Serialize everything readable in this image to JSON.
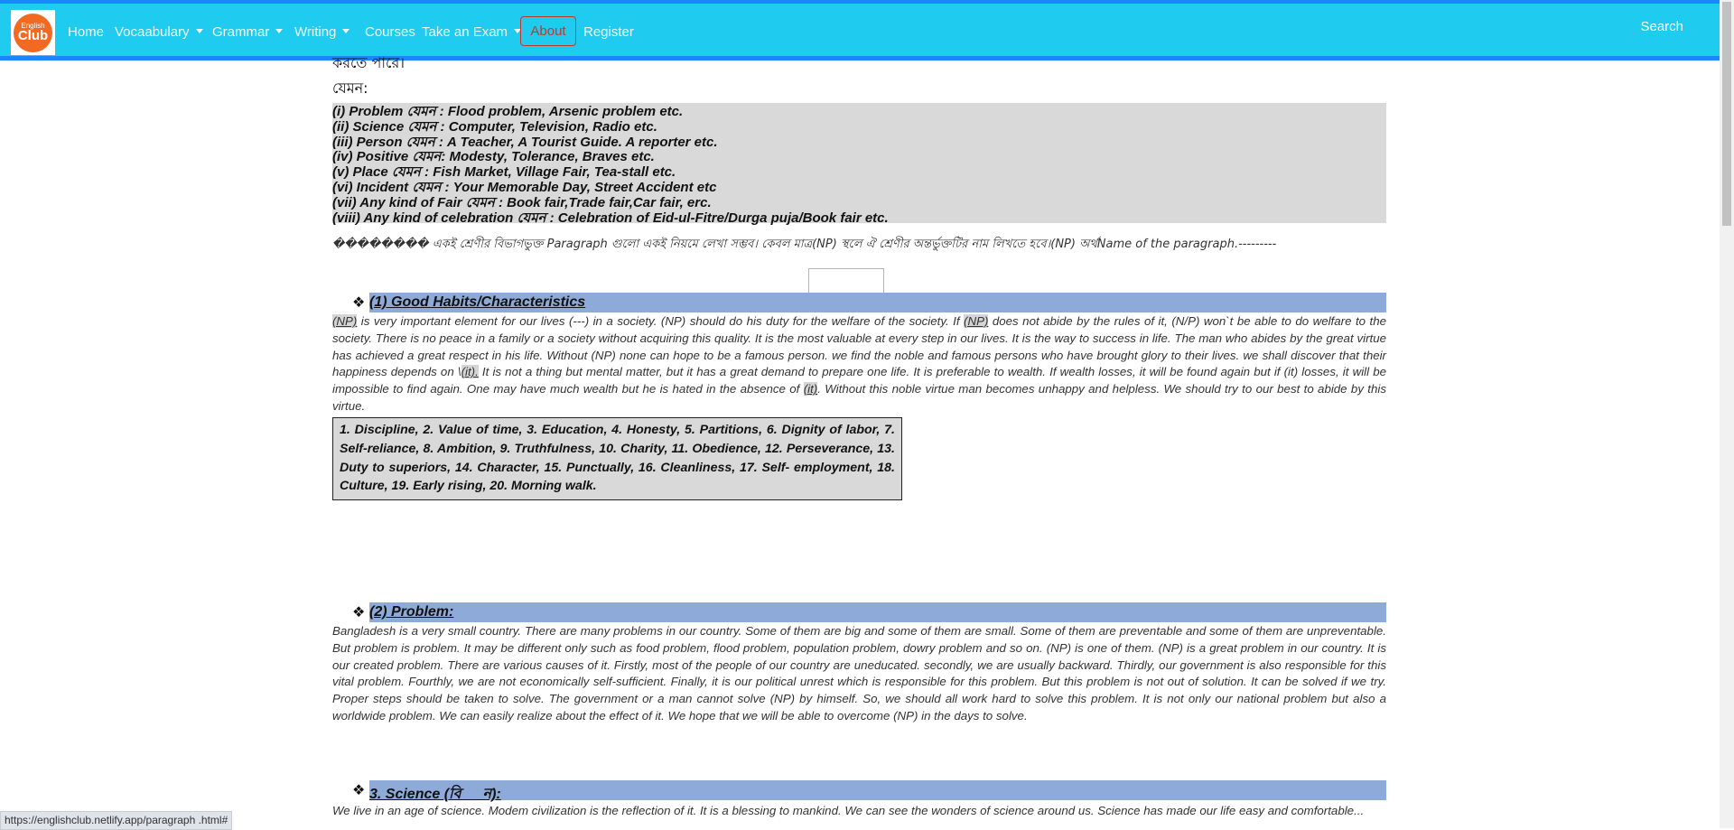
{
  "navbar": {
    "brand": {
      "line1": "English",
      "line2": "Club"
    },
    "items": [
      {
        "label": "Home",
        "dropdown": false
      },
      {
        "label": "Vocaabulary",
        "dropdown": true
      },
      {
        "label": "Grammar",
        "dropdown": true
      },
      {
        "label": "Writing",
        "dropdown": true
      },
      {
        "label": "Courses",
        "dropdown": false
      },
      {
        "label": "Take an Exam",
        "dropdown": true
      },
      {
        "label": "About",
        "dropdown": false
      },
      {
        "label": "Register",
        "dropdown": false
      }
    ],
    "search_label": "Search"
  },
  "content": {
    "cutoff_text": "করতে পারে।",
    "jemon": "যেমন:",
    "examples": [
      "(i) Problem যেমন : Flood problem, Arsenic problem etc.",
      "(ii) Science যেমন : Computer, Television, Radio etc.",
      "(iii) Person যেমন : A Teacher, A Tourist Guide. A reporter etc.",
      "(iv) Positive যেমন: Modesty, Tolerance, Braves etc.",
      "(v) Place যেমন : Fish Market, Village Fair, Tea-stall etc.",
      "(vi) Incident যেমন : Your Memorable Day, Street Accident etc",
      "(vii) Any kind of Fair যেমন : Book fair,Trade fair,Car fair, erc.",
      "(viii) Any kind of celebration  যেমন : Celebration of Eid-ul-Fitre/Durga puja/Book fair etc."
    ],
    "note": "�������� একই শ্রেণীর বিভাগভুক্ত Paragraph গুলো একই নিয়মে লেখা সম্ভব। কেবল মাত্র(NP) স্থলে ঐ শ্রেণীর অন্তর্ভুক্তটির নাম লিখতে হবে।(NP) অর্থName of the paragraph.---------",
    "sections": [
      {
        "bullet": "❖",
        "heading": "(1) Good Habits/Characteristics",
        "body_parts": [
          {
            "hl": true,
            "text": "(NP)"
          },
          {
            "hl": false,
            "text": " is very important element for our lives (---) in a society. (NP) should do his duty for the welfare of the society. If "
          },
          {
            "hl": true,
            "text": "(NP)"
          },
          {
            "hl": false,
            "text": " does not abide by the rules of it, (N/P) won`t be able to do welfare to the society. There is no peace in a family or a society without acquiring this quality. It is the most valuable at every step in our lives.  It is the way to success in life. The man who abides by the great virtue has achieved a great respect in his life. Without (NP) none can hope to be a famous person. we find the noble and famous persons who have brought glory to their lives. we shall discover that their happiness depends on \\"
          },
          {
            "hl": true,
            "text": "(it)."
          },
          {
            "hl": false,
            "text": " It is not a thing but mental matter, but it has a great demand to prepare one life. It is preferable to wealth. If wealth losses, it will be found again but if (it) losses, it will be impossible to find again. One may have much wealth but he is hated in the absence of "
          },
          {
            "hl": true,
            "text": "(it)"
          },
          {
            "hl": false,
            "text": ". Without this noble virtue man becomes unhappy and helpless. We should try to our best to abide by this virtue."
          }
        ],
        "list_box": "1. Discipline, 2. Value of time, 3. Education, 4. Honesty, 5. Partitions, 6. Dignity of labor, 7. Self-reliance, 8. Ambition, 9. Truthfulness, 10. Charity, 11. Obedience, 12. Perseverance, 13. Duty to superiors, 14. Character, 15. Punctually, 16. Cleanliness, 17. Self- employment, 18. Culture, 19. Early rising, 20. Morning walk."
      },
      {
        "bullet": "❖",
        "heading": "(2) Problem:",
        "body": "Bangladesh is a very small country. There are many problems in our country. Some of them are big and some of them are small. Some of them are preventable and some of them are unpreventable. But problem is problem. It may be different only such as food problem, flood problem, population problem, dowry problem and so on. (NP) is one of them. (NP) is a great problem in our country. It is our created problem. There are various causes of it. Firstly, most of the people of our country are uneducated. secondly, we are usually backward. Thirdly, our government is also responsible for this vital problem. Fourthly, we are not economically self-sufficient. Finally, it is our political unrest which is responsible for this problem. But this problem is not out of solution. It can be solved if we try. Proper steps should be taken to solve. The government or a man cannot solve (NP) by himself. So, we should all work hard to solve this problem. It is not only our national problem but also a worldwide problem. We can easily realize about the effect of it. We hope that we will be able to overcome (NP) in the days to solve."
      },
      {
        "bullet": "❖",
        "heading": "3. Science (বি�ান):",
        "body": "We live in an age of science. Modem civilization is the reflection of it. It is a blessing to mankind. We can see the wonders of science around us. Science has made our life easy and comfortable..."
      }
    ]
  },
  "status_bar": {
    "url": "https://englishclub.netlify.app/paragraph .html#"
  },
  "colors": {
    "navbar": "#1fcbef",
    "navbar_border": "#1a86ff",
    "heading_bar": "#8eaad8",
    "about_border": "#c0392b"
  }
}
